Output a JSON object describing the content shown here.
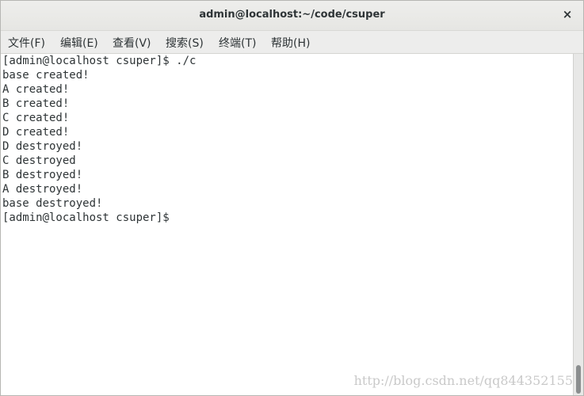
{
  "window": {
    "title": "admin@localhost:~/code/csuper",
    "close_icon": "×"
  },
  "menu": {
    "items": [
      {
        "label": "文件(F)"
      },
      {
        "label": "编辑(E)"
      },
      {
        "label": "查看(V)"
      },
      {
        "label": "搜索(S)"
      },
      {
        "label": "终端(T)"
      },
      {
        "label": "帮助(H)"
      }
    ]
  },
  "terminal": {
    "lines": [
      "[admin@localhost csuper]$ ./c",
      "base created!",
      "A created!",
      "B created!",
      "C created!",
      "D created!",
      "D destroyed!",
      "C destroyed",
      "B destroyed!",
      "A destroyed!",
      "base destroyed!",
      "[admin@localhost csuper]$"
    ]
  },
  "watermark": "http://blog.csdn.net/qq844352155"
}
